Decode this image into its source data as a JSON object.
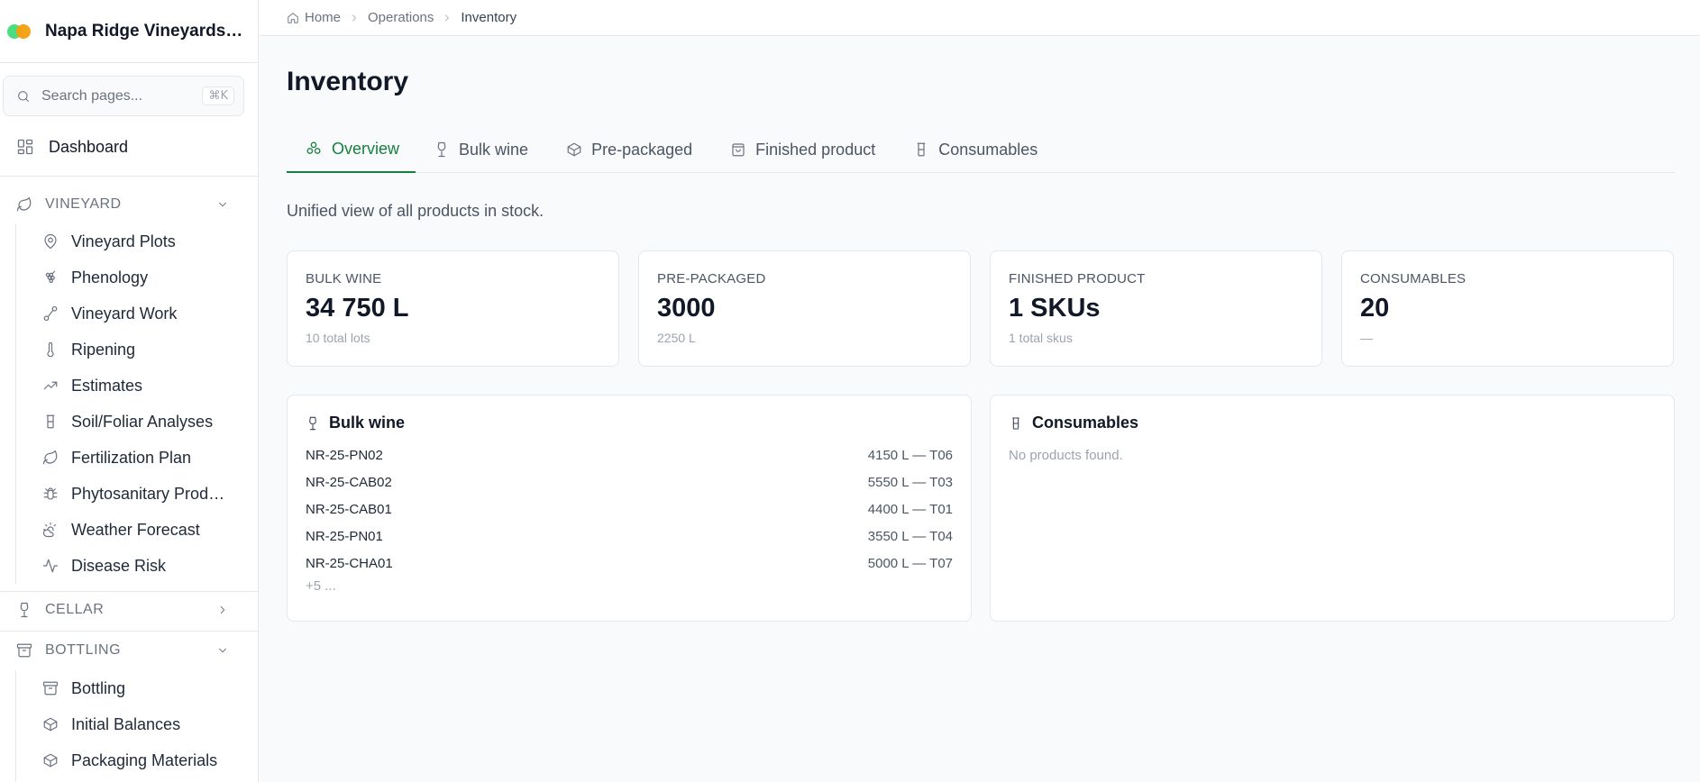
{
  "app": {
    "name": "Napa Ridge Vineyards & Winery",
    "colors": {
      "accent": "#15803d",
      "logo_green": "#4ade80",
      "logo_orange": "#f59e0b"
    }
  },
  "search": {
    "placeholder": "Search pages...",
    "shortcut": "⌘K"
  },
  "sidebar": {
    "dashboard": {
      "label": "Dashboard",
      "icon": "layout-grid-icon"
    },
    "sections": [
      {
        "label": "VINEYARD",
        "icon": "leaf-icon",
        "expanded": true,
        "items": [
          {
            "label": "Vineyard Plots",
            "icon": "map-pin-icon"
          },
          {
            "label": "Phenology",
            "icon": "grape-icon"
          },
          {
            "label": "Vineyard Work",
            "icon": "route-icon"
          },
          {
            "label": "Ripening",
            "icon": "thermometer-icon"
          },
          {
            "label": "Estimates",
            "icon": "trending-up-icon"
          },
          {
            "label": "Soil/Foliar Analyses",
            "icon": "beaker-icon"
          },
          {
            "label": "Fertilization Plan",
            "icon": "leaf-icon"
          },
          {
            "label": "Phytosanitary Products",
            "icon": "bug-icon"
          },
          {
            "label": "Weather Forecast",
            "icon": "cloud-sun-icon"
          },
          {
            "label": "Disease Risk",
            "icon": "activity-icon"
          }
        ]
      },
      {
        "label": "CELLAR",
        "icon": "wine-icon",
        "expanded": false,
        "items": []
      },
      {
        "label": "BOTTLING",
        "icon": "archive-icon",
        "expanded": true,
        "items": [
          {
            "label": "Bottling",
            "icon": "archive-icon"
          },
          {
            "label": "Initial Balances",
            "icon": "package-icon"
          },
          {
            "label": "Packaging Materials",
            "icon": "package-icon"
          }
        ]
      }
    ]
  },
  "breadcrumb": [
    "Home",
    "Operations",
    "Inventory"
  ],
  "page": {
    "title": "Inventory",
    "description": "Unified view of all products in stock."
  },
  "tabs": [
    {
      "label": "Overview",
      "icon": "grapes-icon",
      "active": true
    },
    {
      "label": "Bulk wine",
      "icon": "wine-glass-icon",
      "active": false
    },
    {
      "label": "Pre-packaged",
      "icon": "box-icon",
      "active": false
    },
    {
      "label": "Finished product",
      "icon": "shopping-bag-icon",
      "active": false
    },
    {
      "label": "Consumables",
      "icon": "beaker-icon",
      "active": false
    }
  ],
  "stats": [
    {
      "label": "BULK WINE",
      "value": "34 750 L",
      "sub": "10 total lots"
    },
    {
      "label": "PRE-PACKAGED",
      "value": "3000",
      "sub": "2250 L"
    },
    {
      "label": "FINISHED PRODUCT",
      "value": "1 SKUs",
      "sub": "1 total skus"
    },
    {
      "label": "CONSUMABLES",
      "value": "20",
      "sub": "—"
    }
  ],
  "bulk_panel": {
    "title": "Bulk wine",
    "rows": [
      {
        "lot": "NR-25-PN02",
        "detail": "4150 L — T06"
      },
      {
        "lot": "NR-25-CAB02",
        "detail": "5550 L — T03"
      },
      {
        "lot": "NR-25-CAB01",
        "detail": "4400 L — T01"
      },
      {
        "lot": "NR-25-PN01",
        "detail": "3550 L — T04"
      },
      {
        "lot": "NR-25-CHA01",
        "detail": "5000 L — T07"
      }
    ],
    "more": "+5 ..."
  },
  "consumables_panel": {
    "title": "Consumables",
    "empty": "No products found."
  }
}
